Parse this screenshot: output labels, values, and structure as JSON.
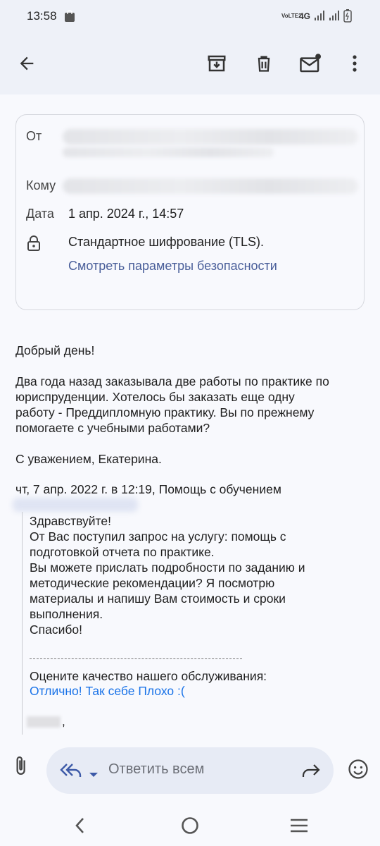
{
  "status_bar": {
    "time": "13:58",
    "volte": "VoLTE2",
    "network": "4G"
  },
  "app_bar": {
    "back_icon": "arrow-back-icon",
    "archive_icon": "archive-icon",
    "delete_icon": "trash-icon",
    "mark_unread_icon": "mail-unread-icon",
    "more_icon": "more-vert-icon"
  },
  "details": {
    "from_label": "От",
    "to_label": "Кому",
    "date_label": "Дата",
    "date_value": "1 апр. 2024 г., 14:57",
    "encryption": "Стандартное шифрование (TLS).",
    "security_link": "Смотреть параметры безопасности"
  },
  "message": {
    "greeting": "Добрый день!",
    "body_lines": [
      "Два года назад заказывала две работы по практике по",
      "юриспруденции. Хотелось бы заказать еще одну",
      "работу - Преддипломную практику. Вы по прежнему",
      "помогаете с учебными работами?"
    ],
    "signature": "С уважением, Екатерина."
  },
  "quoted": {
    "header": "чт, 7 апр. 2022 г. в 12:19, Помощь с обучением",
    "lines": [
      "Здравствуйте!",
      "От Вас поступил запрос на услугу: помощь с",
      "подготовкой отчета по практике.",
      "Вы можете прислать подробности по заданию и",
      "методические рекомендации? Я посмотрю",
      "материалы и напишу Вам стоимость и сроки",
      "выполнения.",
      "Спасибо!"
    ],
    "rating_prompt": "Оцените качество нашего обслуживания:",
    "rating_links": "Отлично! Так себе Плохо :(",
    "after_blur": ","
  },
  "reply_bar": {
    "placeholder": "Ответить всем"
  },
  "colors": {
    "background": "#f8f9fd",
    "bar": "#eef1f8",
    "link": "#1a73e8",
    "security_link": "#4a5f9a"
  }
}
